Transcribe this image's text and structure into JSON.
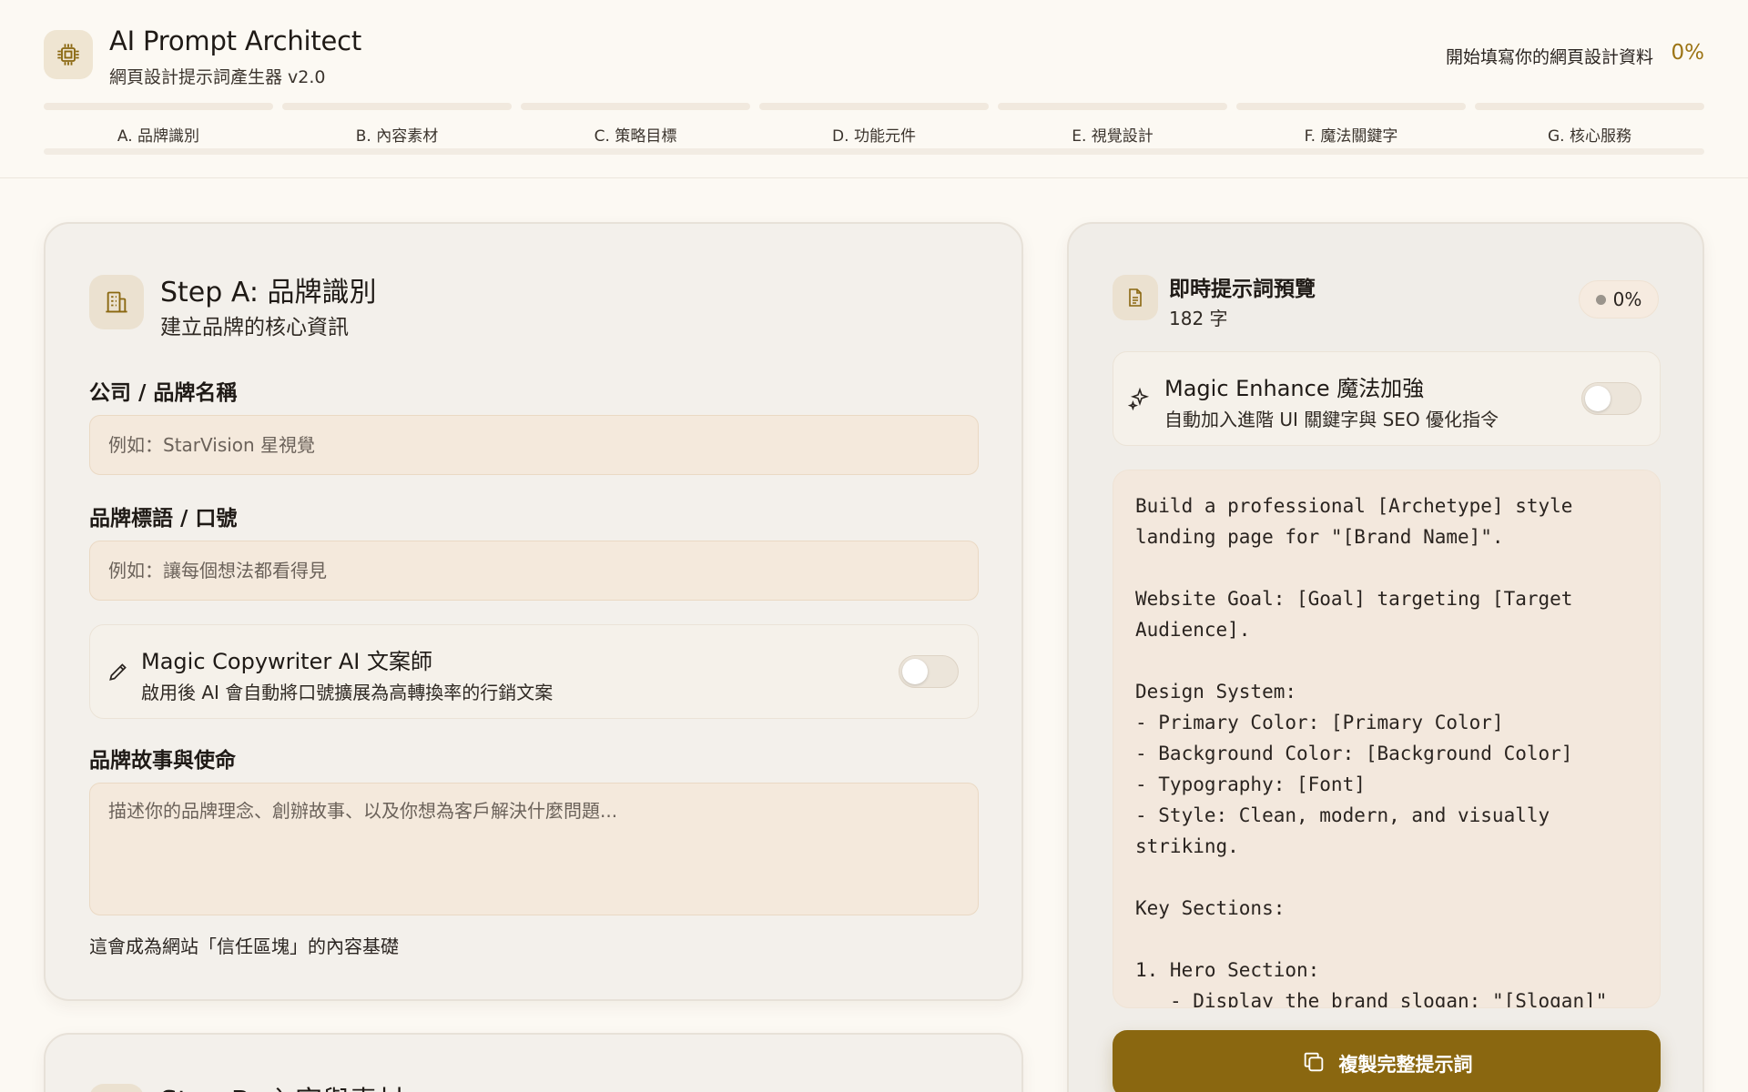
{
  "app": {
    "title": "AI Prompt Architect",
    "subtitle": "網頁設計提示詞產生器 v2.0",
    "progress_label": "開始填寫你的網頁設計資料",
    "progress_percent": "0%",
    "accent_color": "#9c7414",
    "logo_icon": "cpu-chip-icon"
  },
  "steps": [
    {
      "label": "A. 品牌識別"
    },
    {
      "label": "B. 內容素材"
    },
    {
      "label": "C. 策略目標"
    },
    {
      "label": "D. 功能元件"
    },
    {
      "label": "E. 視覺設計"
    },
    {
      "label": "F. 魔法關鍵字"
    },
    {
      "label": "G. 核心服務"
    }
  ],
  "form": {
    "icon": "building-icon",
    "title": "Step A: 品牌識別",
    "subtitle": "建立品牌的核心資訊",
    "brand_name": {
      "label": "公司 / 品牌名稱",
      "placeholder": "例如：StarVision 星視覺",
      "value": ""
    },
    "slogan": {
      "label": "品牌標語 / 口號",
      "placeholder": "例如：讓每個想法都看得見",
      "value": ""
    },
    "copywriter": {
      "icon": "pen-icon",
      "title": "Magic Copywriter AI 文案師",
      "description": "啟用後 AI 會自動將口號擴展為高轉換率的行銷文案",
      "enabled": false
    },
    "story": {
      "label": "品牌故事與使命",
      "placeholder": "描述你的品牌理念、創辦故事、以及你想為客戶解決什麼問題...",
      "value": "",
      "hint": "這會成為網站「信任區塊」的內容基礎"
    }
  },
  "next_section": {
    "icon": "document-icon",
    "title": "Step B: 內容與素材"
  },
  "preview": {
    "icon": "document-icon",
    "title": "即時提示詞預覽",
    "char_count": "182 字",
    "status_percent": "0%",
    "enhance": {
      "icon": "sparkles-icon",
      "title": "Magic Enhance 魔法加強",
      "description": "自動加入進階 UI 關鍵字與 SEO 優化指令",
      "enabled": false
    },
    "prompt_text": "Build a professional [Archetype] style landing page for \"[Brand Name]\".\n\nWebsite Goal: [Goal] targeting [Target Audience].\n\nDesign System:\n- Primary Color: [Primary Color]\n- Background Color: [Background Color]\n- Typography: [Font]\n- Style: Clean, modern, and visually striking.\n\nKey Sections:\n\n1. Hero Section:\n   - Display the brand slogan: \"[Slogan]\"",
    "copy_button": "複製完整提示詞",
    "copy_icon": "copy-icon",
    "button_color": "#8a6710"
  }
}
